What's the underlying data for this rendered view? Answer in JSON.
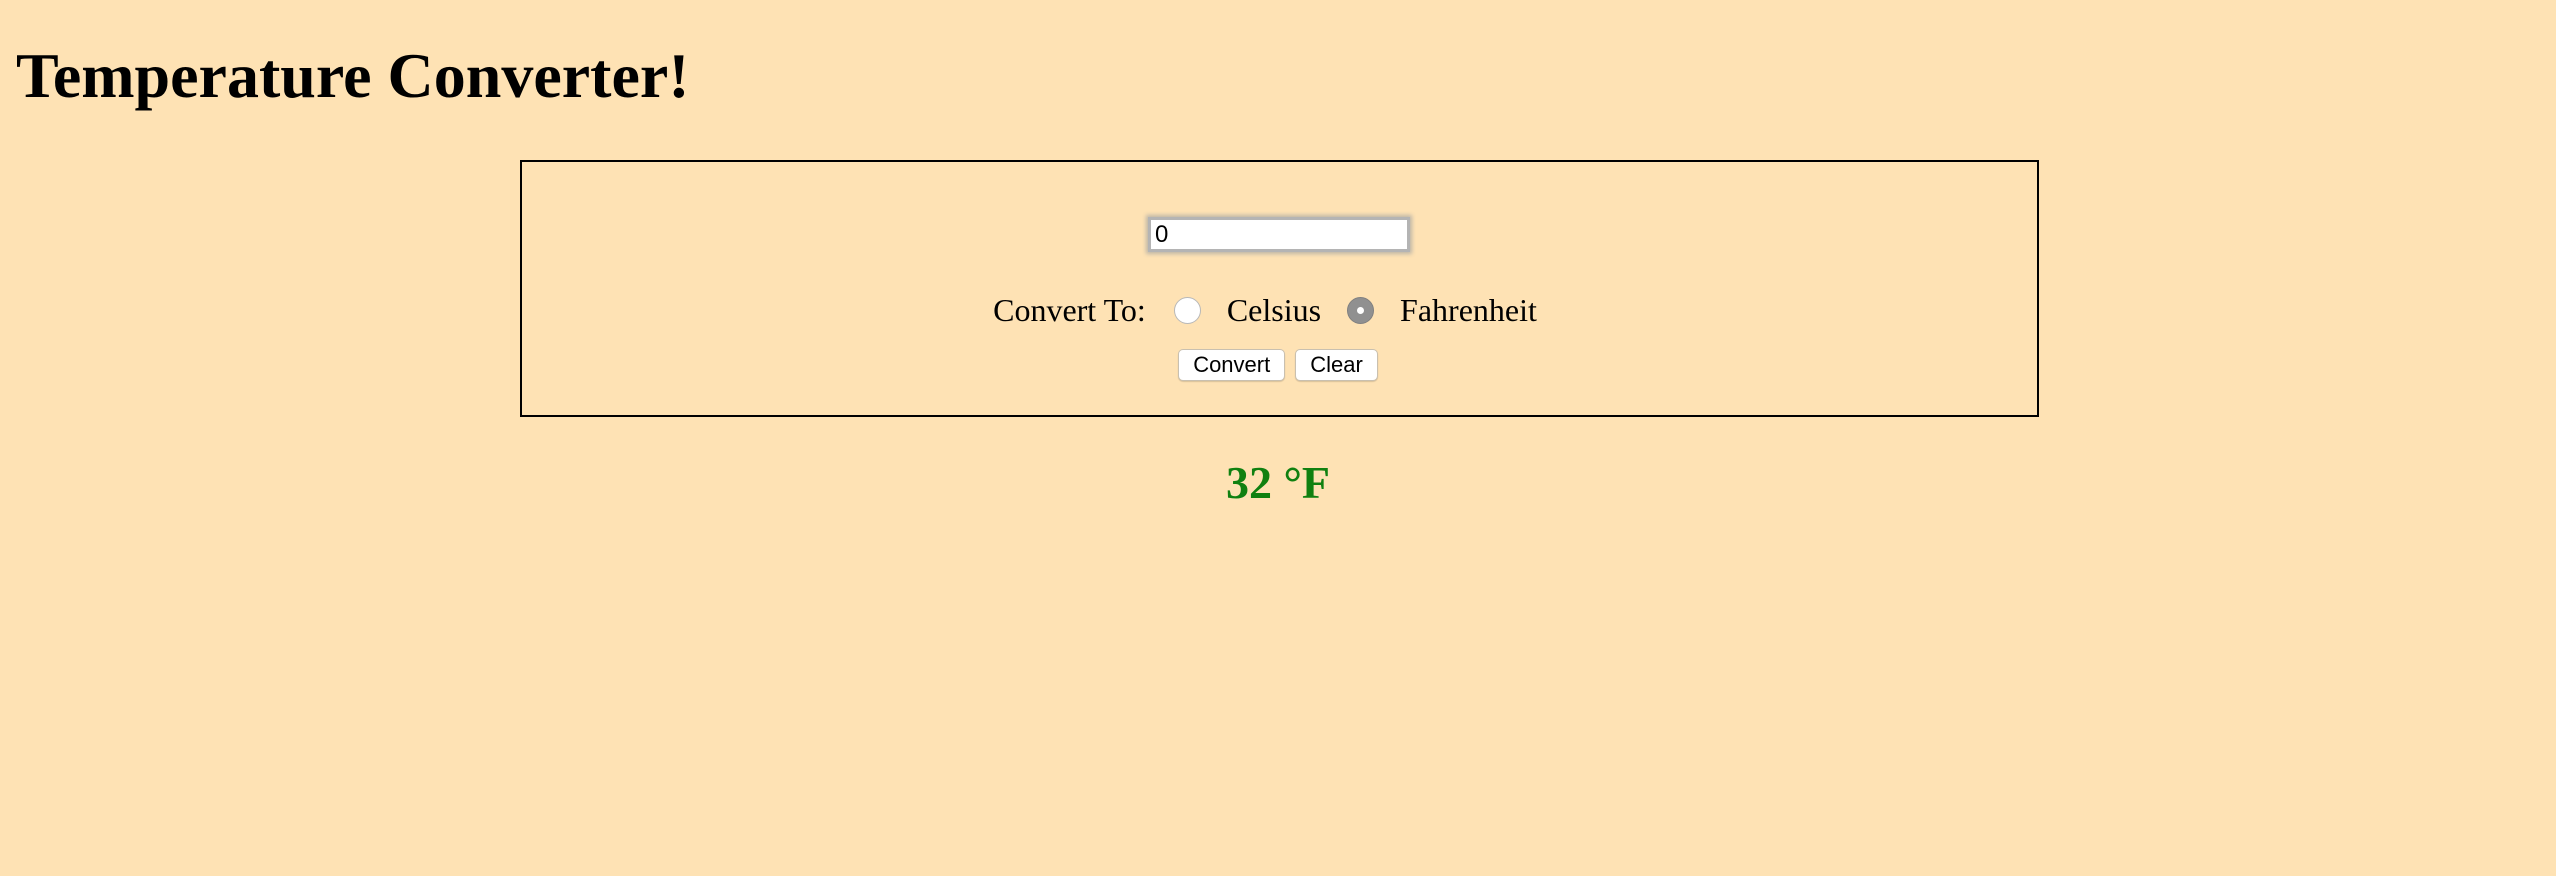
{
  "title": "Temperature Converter!",
  "form": {
    "input_value": "0",
    "convert_to_label": "Convert To:",
    "options": [
      {
        "label": "Celsius",
        "selected": false
      },
      {
        "label": "Fahrenheit",
        "selected": true
      }
    ],
    "convert_label": "Convert",
    "clear_label": "Clear"
  },
  "result": "32 °F",
  "colors": {
    "background": "#fee2b4",
    "result": "#108010"
  }
}
